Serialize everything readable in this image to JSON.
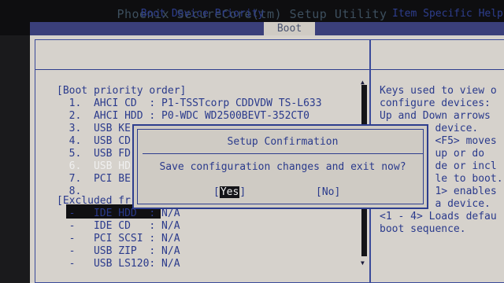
{
  "window": {
    "title": "Phoenix SecureCore(tm) Setup Utility"
  },
  "tabs": [
    {
      "label": "Boot"
    }
  ],
  "left_panel": {
    "title": "Boot Device Priority"
  },
  "right_panel": {
    "title": "Item Specific Help"
  },
  "boot_list": [
    "[Boot priority order]",
    "  1.  AHCI CD  : P1-TSSTcorp CDDVDW TS-L633",
    "  2.  AHCI HDD : P0-WDC WD2500BEVT-352CT0",
    "  3.  USB KE",
    "  4.  USB CD",
    "  5.  USB FD",
    "  6.  USB HD",
    "  7.  PCI BE",
    "  8.",
    "[Excluded fr",
    "  -   IDE HDD  : N/A",
    "  -   IDE CD   : N/A",
    "  -   PCI SCSI : N/A",
    "  -   USB ZIP  : N/A",
    "  -   USB LS120: N/A"
  ],
  "help_lines": [
    "Keys used to view o",
    "configure devices:",
    "Up and Down arrows",
    "         device.",
    "         <F5> moves",
    "         up or do",
    "         de or incl",
    "         le to boot.",
    "         1> enables",
    "         a device.",
    "<1 - 4> Loads defau",
    "boot sequence."
  ],
  "dialog": {
    "title": "Setup Confirmation",
    "message": "Save configuration changes and exit now?",
    "yes_label": "Yes",
    "no_label": "No"
  }
}
